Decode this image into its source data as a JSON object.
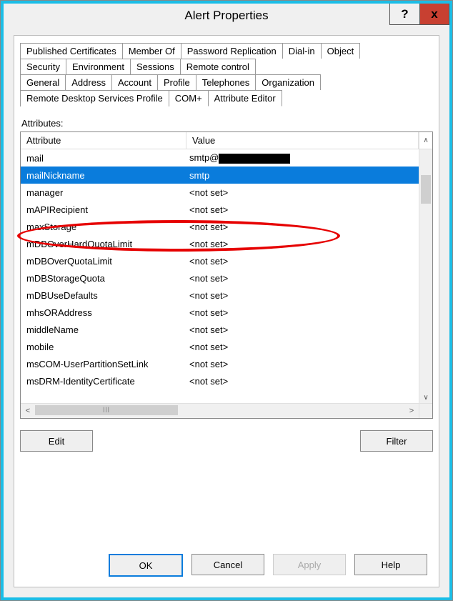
{
  "window": {
    "title": "Alert Properties",
    "help_glyph": "?",
    "close_glyph": "x"
  },
  "tabs": {
    "row1": [
      "Published Certificates",
      "Member Of",
      "Password Replication",
      "Dial-in",
      "Object"
    ],
    "row2": [
      "Security",
      "Environment",
      "Sessions",
      "Remote control"
    ],
    "row3": [
      "General",
      "Address",
      "Account",
      "Profile",
      "Telephones",
      "Organization"
    ],
    "row4": [
      "Remote Desktop Services Profile",
      "COM+",
      "Attribute Editor"
    ],
    "active": "Attribute Editor"
  },
  "panel": {
    "label": "Attributes:",
    "columns": {
      "attr": "Attribute",
      "val": "Value"
    },
    "rows": [
      {
        "attr": "mail",
        "val_prefix": "smtp@",
        "redacted": true
      },
      {
        "attr": "mailNickname",
        "val": "smtp",
        "selected": true
      },
      {
        "attr": "manager",
        "val": "<not set>"
      },
      {
        "attr": "mAPIRecipient",
        "val": "<not set>"
      },
      {
        "attr": "maxStorage",
        "val": "<not set>"
      },
      {
        "attr": "mDBOverHardQuotaLimit",
        "val": "<not set>"
      },
      {
        "attr": "mDBOverQuotaLimit",
        "val": "<not set>"
      },
      {
        "attr": "mDBStorageQuota",
        "val": "<not set>"
      },
      {
        "attr": "mDBUseDefaults",
        "val": "<not set>"
      },
      {
        "attr": "mhsORAddress",
        "val": "<not set>"
      },
      {
        "attr": "middleName",
        "val": "<not set>"
      },
      {
        "attr": "mobile",
        "val": "<not set>"
      },
      {
        "attr": "msCOM-UserPartitionSetLink",
        "val": "<not set>"
      },
      {
        "attr": "msDRM-IdentityCertificate",
        "val": "<not set>"
      }
    ],
    "buttons": {
      "edit": "Edit",
      "filter": "Filter"
    }
  },
  "dialog_buttons": {
    "ok": "OK",
    "cancel": "Cancel",
    "apply": "Apply",
    "help": "Help"
  }
}
